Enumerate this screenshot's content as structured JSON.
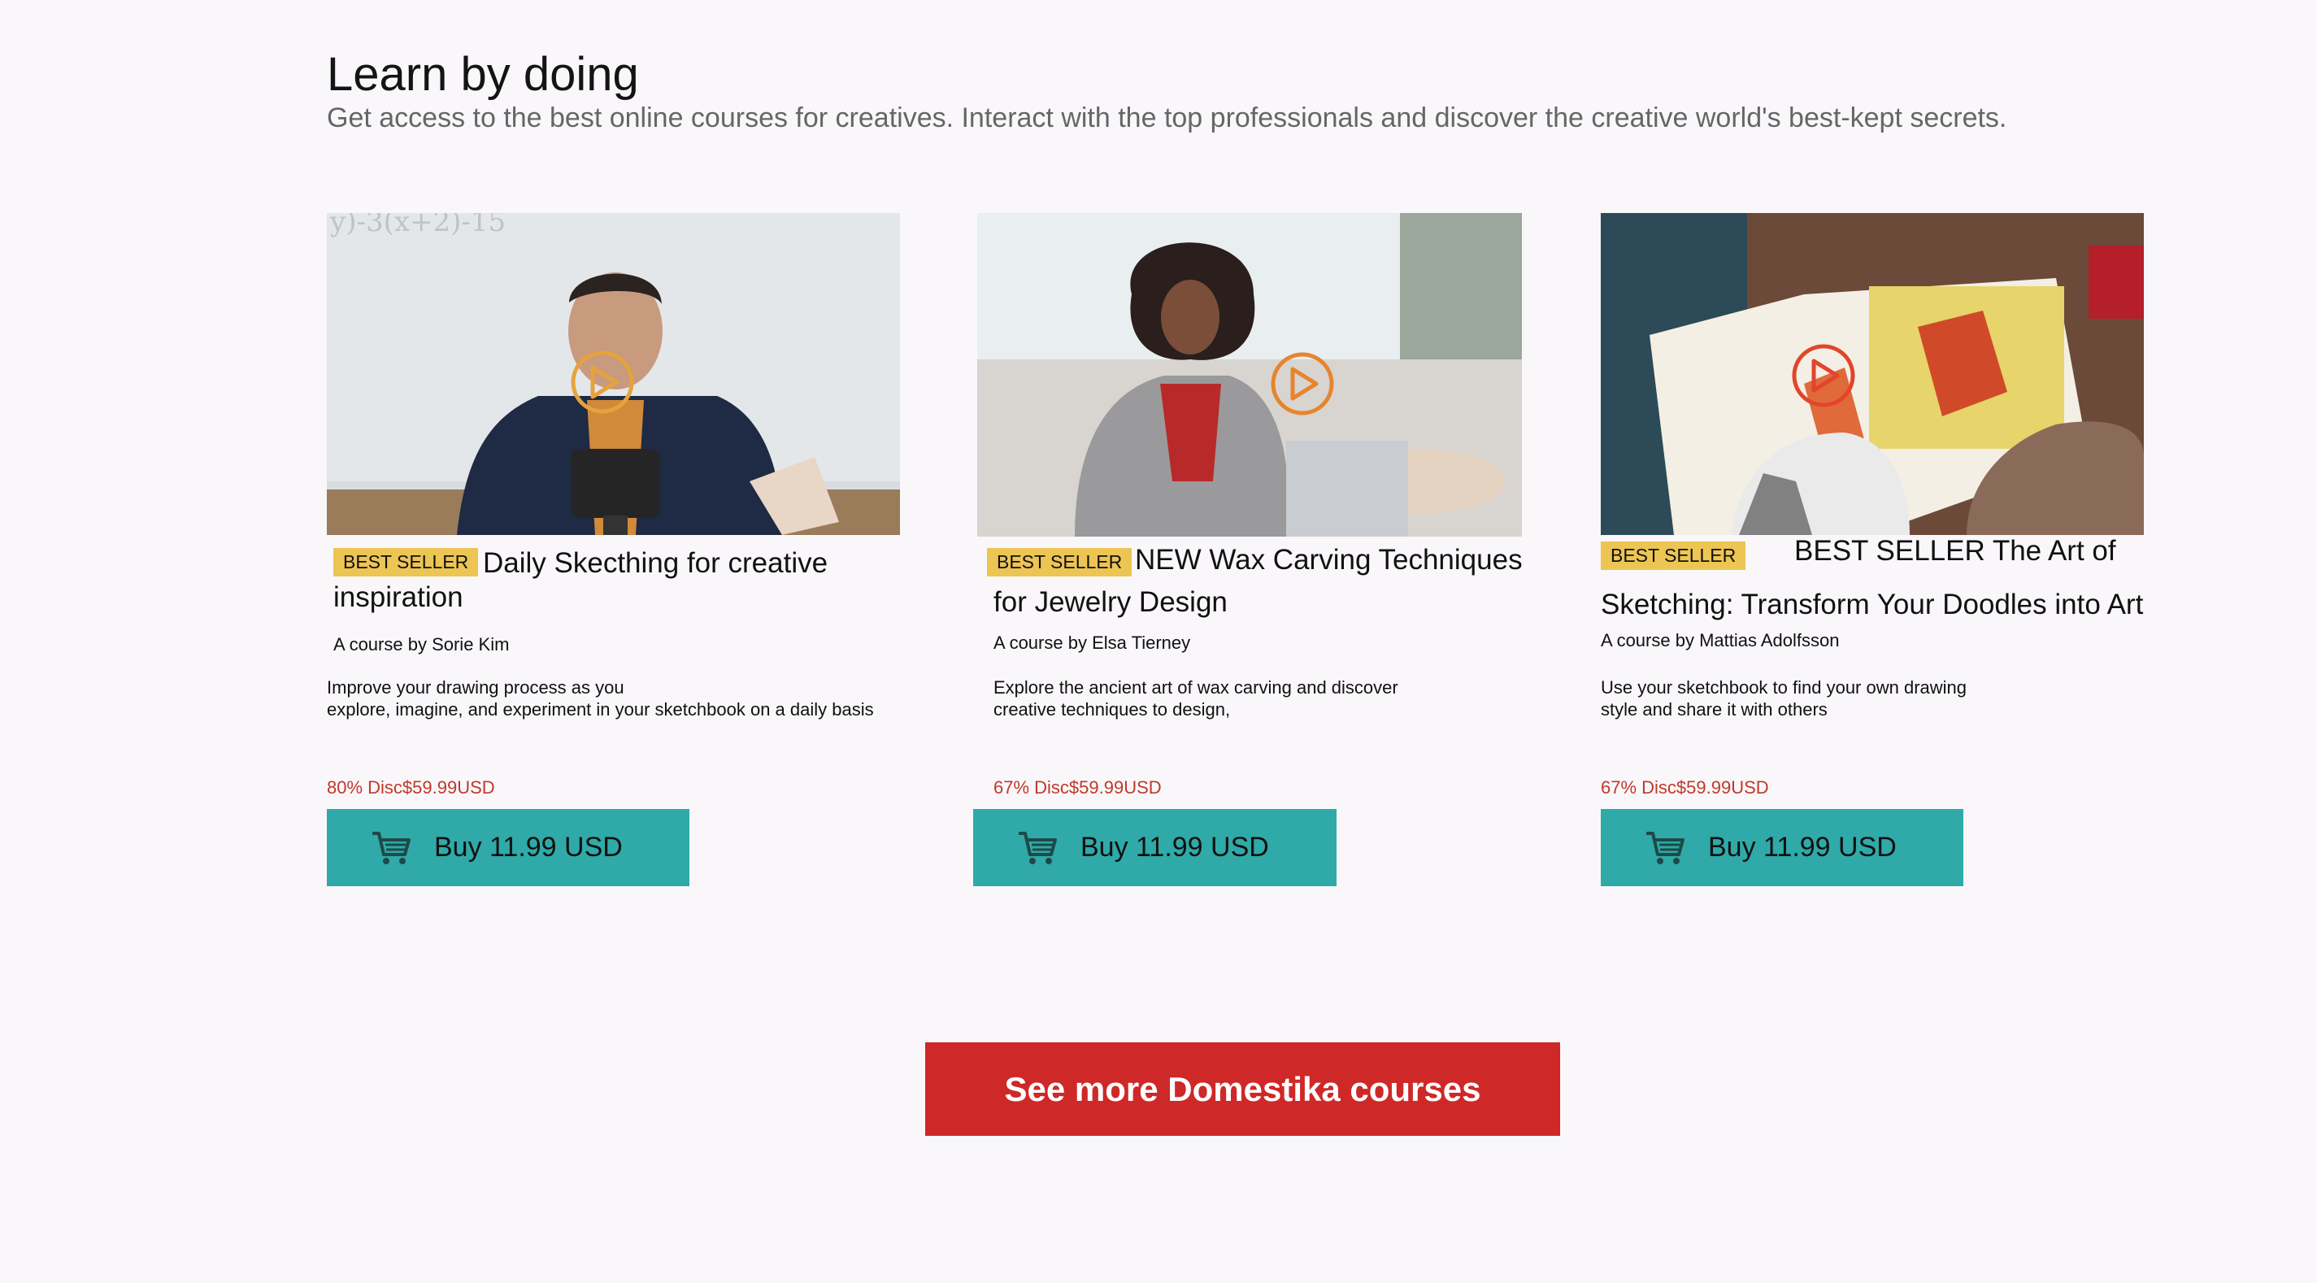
{
  "header": {
    "title": "Learn by doing",
    "subtitle": "Get access to the best online courses for creatives. Interact with the top professionals and discover the creative world's best-kept secrets."
  },
  "courses": [
    {
      "badge": "BEST SELLER",
      "title": "Daily Skecthing for creative inspiration",
      "author": "A course by Sorie Kim",
      "desc_line1": "Improve your drawing process as you",
      "desc_line2": "explore, imagine, and experiment in your sketchbook on a daily basis",
      "discount": "80% Disc$59.99USD",
      "buy_label": "Buy 11.99 USD",
      "image": "instructor-filming-video-photo"
    },
    {
      "badge": "BEST SELLER",
      "title_line1": "NEW Wax Carving Techniques",
      "title_line2": "for Jewelry Design",
      "author": "A course by Elsa Tierney",
      "desc_line1": "Explore the ancient art of wax carving and discover",
      "desc_line2": "creative techniques to design,",
      "discount": "67% Disc$59.99USD",
      "buy_label": "Buy 11.99 USD",
      "image": "woman-presenting-laptop-photo"
    },
    {
      "badge": "BEST SELLER",
      "title_line1": "BEST SELLER The Art of",
      "title_line2": "Sketching: Transform Your Doodles into Art",
      "author": "A course by Mattias Adolfsson",
      "desc_line1": "Use your sketchbook to find your own drawing",
      "desc_line2": "style and share it with others",
      "discount": "67% Disc$59.99USD",
      "buy_label": "Buy 11.99 USD",
      "image": "child-reading-picture-book-photo"
    }
  ],
  "cta": {
    "label": "See more Domestika courses"
  },
  "icons": {
    "play": "play-circle-icon",
    "cart": "shopping-cart-icon"
  },
  "colors": {
    "background": "#f9f7fa",
    "badge": "#ecc553",
    "buy_button": "#2faaa8",
    "discount_text": "#c0392b",
    "cta_button": "#cf2828"
  }
}
